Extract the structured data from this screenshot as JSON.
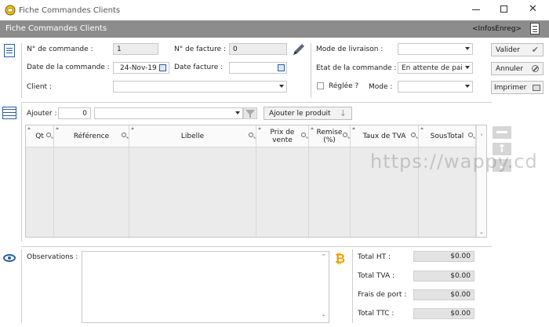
{
  "window": {
    "title": "Fiche Commandes Clients"
  },
  "header": {
    "title": "Fiche Commandes Clients",
    "infos": "<InfosEnreg>"
  },
  "form": {
    "no_commande_label": "N° de commande :",
    "no_commande_value": "1",
    "no_facture_label": "N° de facture :",
    "no_facture_value": "0",
    "date_commande_label": "Date de la commande :",
    "date_commande_value": "24-Nov-19",
    "date_facture_label": "Date facture :",
    "date_facture_value": "",
    "client_label": "Client :",
    "client_value": "",
    "mode_livraison_label": "Mode de livraison :",
    "mode_livraison_value": "",
    "etat_commande_label": "Etat de la commande :",
    "etat_commande_value": "En attente de pai",
    "reglee_label": "Réglée ?",
    "mode_label": "Mode :",
    "mode_value": ""
  },
  "buttons": {
    "valider": "Valider",
    "annuler": "Annuler",
    "imprimer": "Imprimer",
    "ajouter_produit": "Ajouter le produit"
  },
  "ajouter": {
    "label": "Ajouter :",
    "qty": "0",
    "product": ""
  },
  "table": {
    "columns": [
      "Qt",
      "Référence",
      "Libelle",
      "Prix de vente",
      "Remise (%)",
      "Taux de TVA",
      "SousTotal"
    ]
  },
  "observations": {
    "label": "Observations :",
    "value": ""
  },
  "totals": {
    "ht_label": "Total HT :",
    "ht_value": "$0.00",
    "tva_label": "Total TVA :",
    "tva_value": "$0.00",
    "port_label": "Frais de port :",
    "port_value": "$0.00",
    "ttc_label": "Total TTC :",
    "ttc_value": "$0.00"
  },
  "watermark": "https://wappy.cd"
}
